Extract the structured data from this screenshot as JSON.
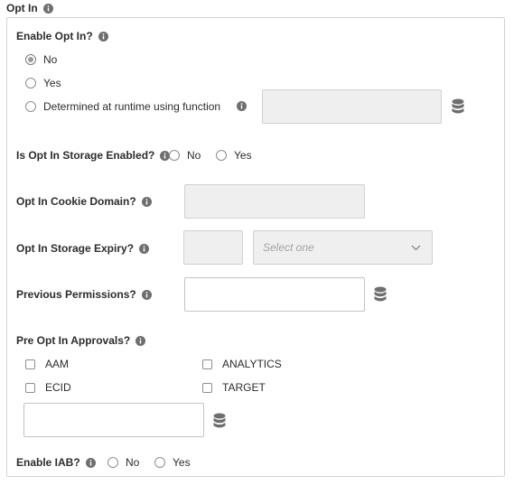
{
  "section": {
    "title": "Opt In"
  },
  "enable_opt_in": {
    "label": "Enable Opt In?",
    "options": [
      "No",
      "Yes",
      "Determined at runtime using function"
    ],
    "selected": "No",
    "function_value": ""
  },
  "storage_enabled": {
    "label": "Is Opt In Storage Enabled?",
    "options": [
      "No",
      "Yes"
    ],
    "selected": ""
  },
  "cookie_domain": {
    "label": "Opt In Cookie Domain?",
    "value": ""
  },
  "storage_expiry": {
    "label": "Opt In Storage Expiry?",
    "value": "",
    "select_placeholder": "Select one"
  },
  "previous_permissions": {
    "label": "Previous Permissions?",
    "value": ""
  },
  "pre_approvals": {
    "label": "Pre Opt In Approvals?",
    "items": [
      "AAM",
      "ANALYTICS",
      "ECID",
      "TARGET"
    ],
    "value": ""
  },
  "iab": {
    "label": "Enable IAB?",
    "options": [
      "No",
      "Yes"
    ],
    "selected": ""
  },
  "icons": {
    "info": "info-icon",
    "data_element": "database-icon",
    "dropdown": "chevron-down-icon"
  },
  "colors": {
    "panel_border": "#d3d3d3",
    "disabled_fill": "#efefef",
    "icon": "#6e6e6e",
    "text": "#2c2c2c"
  }
}
